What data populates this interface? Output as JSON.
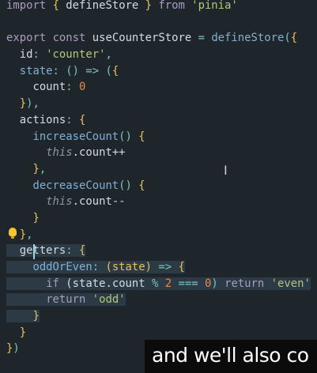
{
  "editor": {
    "lines": [
      [
        [
          "import",
          "kw"
        ],
        [
          " ",
          ""
        ],
        [
          "{",
          "br"
        ],
        [
          " defineStore ",
          "id"
        ],
        [
          "}",
          "br"
        ],
        [
          " ",
          ""
        ],
        [
          "from",
          "kw"
        ],
        [
          " 'pinia'",
          "str"
        ]
      ],
      [],
      [
        [
          "export",
          "kw"
        ],
        [
          " ",
          ""
        ],
        [
          "const",
          "kw"
        ],
        [
          " useCounterStore ",
          "id"
        ],
        [
          "=",
          "pun"
        ],
        [
          " ",
          ""
        ],
        [
          "defineStore",
          "fn"
        ],
        [
          "(",
          "pun"
        ],
        [
          "{",
          "br"
        ]
      ],
      [
        [
          "  id",
          "id"
        ],
        [
          ": ",
          "pun"
        ],
        [
          "'counter'",
          "str"
        ],
        [
          ",",
          "pun"
        ]
      ],
      [
        [
          "  state",
          "prop"
        ],
        [
          ": ",
          "pun"
        ],
        [
          "() => (",
          "pun"
        ],
        [
          "{",
          "br"
        ]
      ],
      [
        [
          "    count",
          "id"
        ],
        [
          ": ",
          "pun"
        ],
        [
          "0",
          "num"
        ]
      ],
      [
        [
          "  ",
          ""
        ],
        [
          "}",
          "br"
        ],
        [
          "),",
          "pun"
        ]
      ],
      [
        [
          "  actions",
          "id"
        ],
        [
          ": ",
          "pun"
        ],
        [
          "{",
          "br"
        ]
      ],
      [
        [
          "    increaseCount",
          "fn"
        ],
        [
          "() ",
          "pun"
        ],
        [
          "{",
          "br"
        ]
      ],
      [
        [
          "      ",
          ""
        ],
        [
          "this",
          "this"
        ],
        [
          ".count++",
          "id"
        ]
      ],
      [
        [
          "    ",
          ""
        ],
        [
          "}",
          "br"
        ],
        [
          ",",
          "pun"
        ]
      ],
      [
        [
          "    decreaseCount",
          "fn"
        ],
        [
          "() ",
          "pun"
        ],
        [
          "{",
          "br"
        ]
      ],
      [
        [
          "      ",
          ""
        ],
        [
          "this",
          "this"
        ],
        [
          ".count--",
          "id"
        ]
      ],
      [
        [
          "    ",
          ""
        ],
        [
          "}",
          "br"
        ]
      ],
      [
        [
          "  ",
          ""
        ],
        [
          "}",
          "br"
        ],
        [
          ",",
          "pun"
        ]
      ],
      [
        [
          "  getters",
          "id"
        ],
        [
          ": ",
          "pun"
        ],
        [
          "{",
          "br"
        ]
      ],
      [
        [
          "    oddOrEven",
          "prop"
        ],
        [
          ": ",
          "pun"
        ],
        [
          "(state)",
          "br"
        ],
        [
          " => ",
          "pun"
        ],
        [
          "{",
          "br"
        ]
      ],
      [
        [
          "      ",
          ""
        ],
        [
          "if",
          "kw"
        ],
        [
          " (state.count ",
          "id"
        ],
        [
          "%",
          "pun"
        ],
        [
          " ",
          ""
        ],
        [
          "2",
          "num"
        ],
        [
          " ",
          ""
        ],
        [
          "===",
          "pun"
        ],
        [
          " ",
          ""
        ],
        [
          "0",
          "num"
        ],
        [
          ") ",
          "pun"
        ],
        [
          "return",
          "kw"
        ],
        [
          " ",
          ""
        ],
        [
          "'even'",
          "str"
        ]
      ],
      [
        [
          "      ",
          ""
        ],
        [
          "return",
          "kw"
        ],
        [
          " ",
          ""
        ],
        [
          "'odd'",
          "str"
        ]
      ],
      [
        [
          "    ",
          ""
        ],
        [
          "}",
          "br"
        ]
      ],
      [
        [
          "  ",
          ""
        ],
        [
          "}",
          "br"
        ]
      ],
      [
        [
          "}",
          "br"
        ],
        [
          ")",
          "pun"
        ]
      ]
    ],
    "lightbulb_icon": "lightbulb-icon",
    "text_cursor_icon": "i-beam-cursor"
  },
  "subtitle": {
    "text": "and we'll also co"
  }
}
